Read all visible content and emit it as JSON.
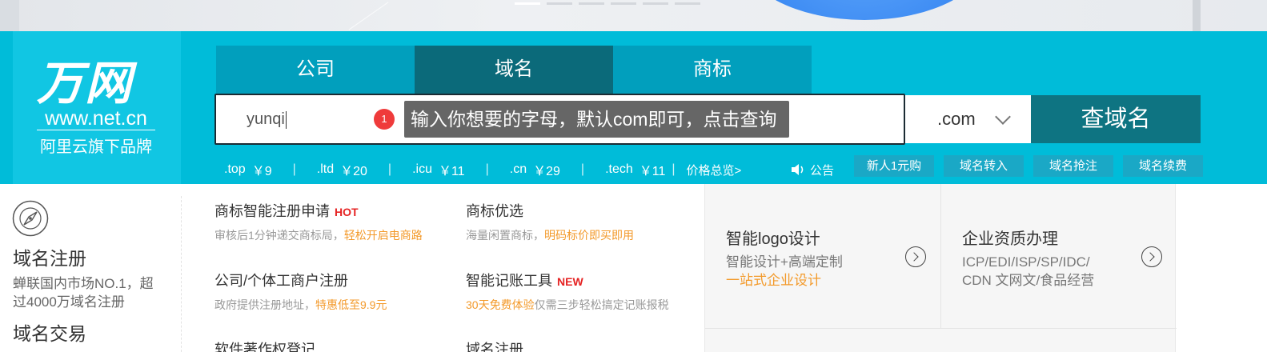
{
  "logo": {
    "main": "万网",
    "url": "www.net.cn",
    "sub": "阿里云旗下品牌"
  },
  "tabs": [
    {
      "label": "公司"
    },
    {
      "label": "域名",
      "active": true
    },
    {
      "label": "商标"
    }
  ],
  "search": {
    "value": "yunqi",
    "suffix": ".com",
    "button": "查域名"
  },
  "tooltip": {
    "step": "1",
    "text": "输入你想要的字母，默认com即可，点击查询"
  },
  "prices": [
    {
      "suffix": ".top",
      "price": "￥9"
    },
    {
      "suffix": ".ltd",
      "price": "￥20"
    },
    {
      "suffix": ".icu",
      "price": "￥11"
    },
    {
      "suffix": ".cn",
      "price": "￥29"
    },
    {
      "suffix": ".tech",
      "price": "￥11"
    }
  ],
  "price_overview": "价格总览>",
  "notice": "公告",
  "quick_buttons": [
    "新人1元购",
    "域名转入",
    "域名抢注",
    "域名续费"
  ],
  "left_column": {
    "title": "域名注册",
    "desc": "蝉联国内市场NO.1，超过4000万域名注册",
    "title2": "域名交易"
  },
  "services": [
    {
      "title": "商标智能注册申请",
      "tag": "HOT",
      "desc": "审核后1分钟递交商标局，",
      "highlight": "轻松开启电商路"
    },
    {
      "title": "商标优选",
      "desc": "海量闲置商标，",
      "highlight": "明码标价即买即用"
    },
    {
      "title": "公司/个体工商户注册",
      "desc": "政府提供注册地址，",
      "highlight": "特惠低至9.9元"
    },
    {
      "title": "智能记账工具",
      "tag": "NEW",
      "highlight": "30天免费体验",
      "desc": "仅需三步轻松搞定记账报税"
    },
    {
      "title": "软件著作权登记"
    },
    {
      "title": "域名注册"
    }
  ],
  "panels": [
    {
      "title": "智能logo设计",
      "desc": "智能设计+高端定制",
      "highlight": "一站式企业设计"
    },
    {
      "title": "企业资质办理",
      "desc1": "ICP/EDI/ISP/SP/IDC/",
      "desc2": "CDN 文网文/食品经营"
    }
  ],
  "colors": {
    "bar": "#00bcd9",
    "tab_active": "#0b6a7a",
    "button": "#0e7482",
    "hot": "#e52323",
    "highlight": "#f39a2b"
  }
}
